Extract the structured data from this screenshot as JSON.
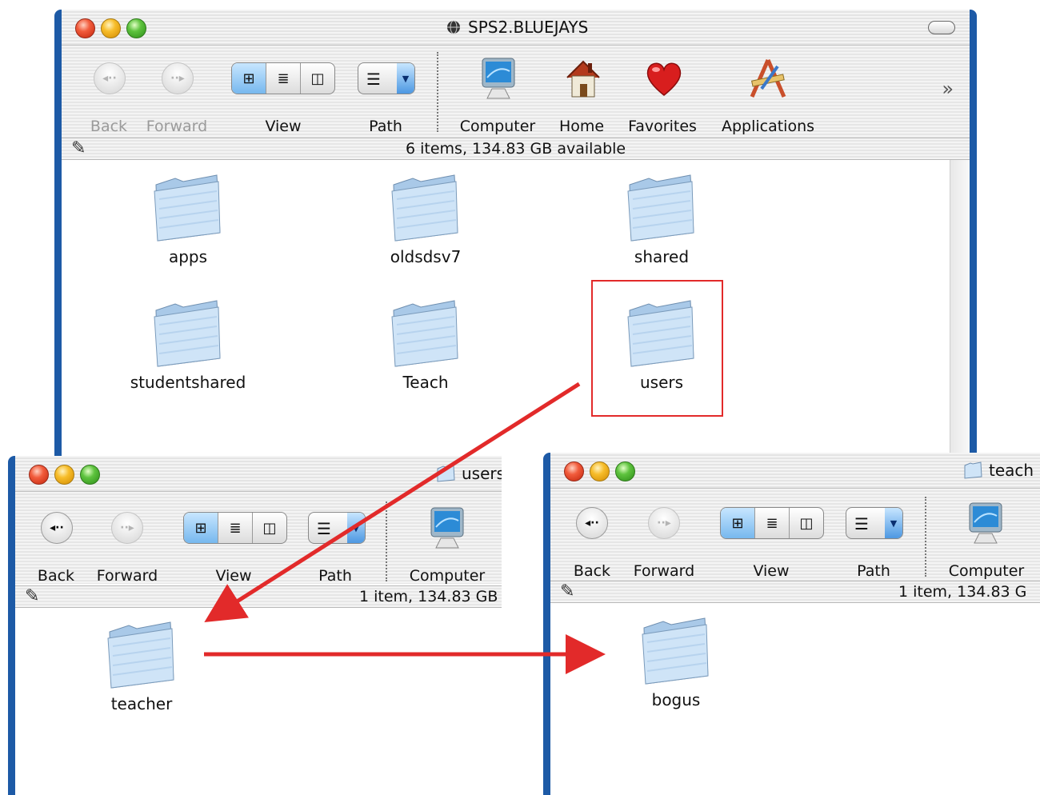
{
  "main_window": {
    "title": "SPS2.BLUEJAYS",
    "toolbar": {
      "back_label": "Back",
      "forward_label": "Forward",
      "view_label": "View",
      "path_label": "Path",
      "computer_label": "Computer",
      "home_label": "Home",
      "favorites_label": "Favorites",
      "applications_label": "Applications",
      "overflow": "»"
    },
    "status": "6 items, 134.83 GB available",
    "items": [
      {
        "label": "apps"
      },
      {
        "label": "oldsdsv7"
      },
      {
        "label": "shared"
      },
      {
        "label": "studentshared"
      },
      {
        "label": "Teach"
      },
      {
        "label": "users"
      }
    ]
  },
  "users_window": {
    "title": "users",
    "toolbar": {
      "back_label": "Back",
      "forward_label": "Forward",
      "view_label": "View",
      "path_label": "Path",
      "computer_label": "Computer"
    },
    "status": "1 item, 134.83 GB",
    "items": [
      {
        "label": "teacher"
      }
    ]
  },
  "teacher_window": {
    "title": "teach",
    "toolbar": {
      "back_label": "Back",
      "forward_label": "Forward",
      "view_label": "View",
      "path_label": "Path",
      "computer_label": "Computer"
    },
    "status": "1 item, 134.83 G",
    "items": [
      {
        "label": "bogus"
      }
    ]
  },
  "colors": {
    "window_frame": "#1d5aa6",
    "annotation_red": "#e22a2a"
  },
  "icons": {
    "back": "back-arrow-icon",
    "forward": "forward-arrow-icon",
    "path": "path-popup-icon",
    "computer": "computer-icon",
    "home": "home-icon",
    "favorites": "heart-icon",
    "applications": "applications-icon",
    "folder": "folder-icon",
    "pen": "pen-icon"
  }
}
